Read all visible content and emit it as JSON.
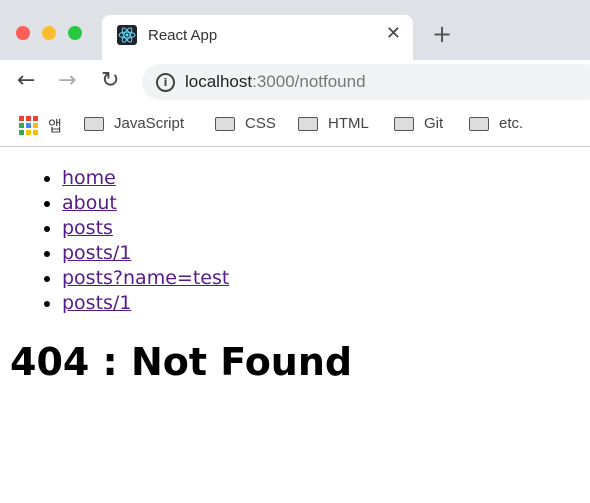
{
  "browser": {
    "tab_title": "React App",
    "url_host": "localhost",
    "url_path": ":3000/notfound",
    "bookmarks": [
      {
        "label": "앱",
        "icon": "apps-icon"
      },
      {
        "label": "JavaScript",
        "icon": "folder-icon"
      },
      {
        "label": "CSS",
        "icon": "folder-icon"
      },
      {
        "label": "HTML",
        "icon": "folder-icon"
      },
      {
        "label": "Git",
        "icon": "folder-icon"
      },
      {
        "label": "etc.",
        "icon": "folder-icon"
      }
    ]
  },
  "nav_links": [
    "home",
    "about",
    "posts",
    "posts/1",
    "posts?name=test",
    "posts/1"
  ],
  "heading": "404 : Not Found",
  "colors": {
    "link": "#551a8b",
    "close": "#ff5f57",
    "minimize": "#febc2e",
    "maximize": "#28c840"
  }
}
